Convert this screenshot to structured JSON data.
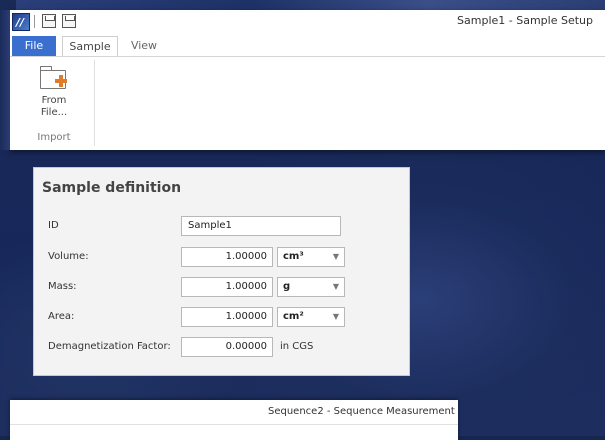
{
  "main_window": {
    "title": "Sample1 - Sample Setup",
    "tabs": [
      {
        "label": "File"
      },
      {
        "label": "Sample"
      },
      {
        "label": "View"
      }
    ],
    "ribbon": {
      "from_file_line1": "From",
      "from_file_line2": "File...",
      "group_label": "Import"
    }
  },
  "sample_definition": {
    "title": "Sample definition",
    "id": {
      "label": "ID",
      "value": "Sample1"
    },
    "volume": {
      "label": "Volume:",
      "value": "1.00000",
      "unit": "cm³"
    },
    "mass": {
      "label": "Mass:",
      "value": "1.00000",
      "unit": "g"
    },
    "area": {
      "label": "Area:",
      "value": "1.00000",
      "unit": "cm²"
    },
    "demag": {
      "label": "Demagnetization Factor:",
      "value": "0.00000",
      "unit": "in CGS"
    }
  },
  "bottom_window": {
    "title": "Sequence2 - Sequence Measurement"
  },
  "icons": {
    "app": "app-logo-icon",
    "save": "save-icon",
    "save_all": "save-all-icon",
    "import": "folder-add-icon",
    "dropdown": "chevron-down-icon"
  },
  "colors": {
    "file_tab": "#3a6fd0",
    "import_plus": "#e07b2a",
    "desktop": "#16264f"
  }
}
